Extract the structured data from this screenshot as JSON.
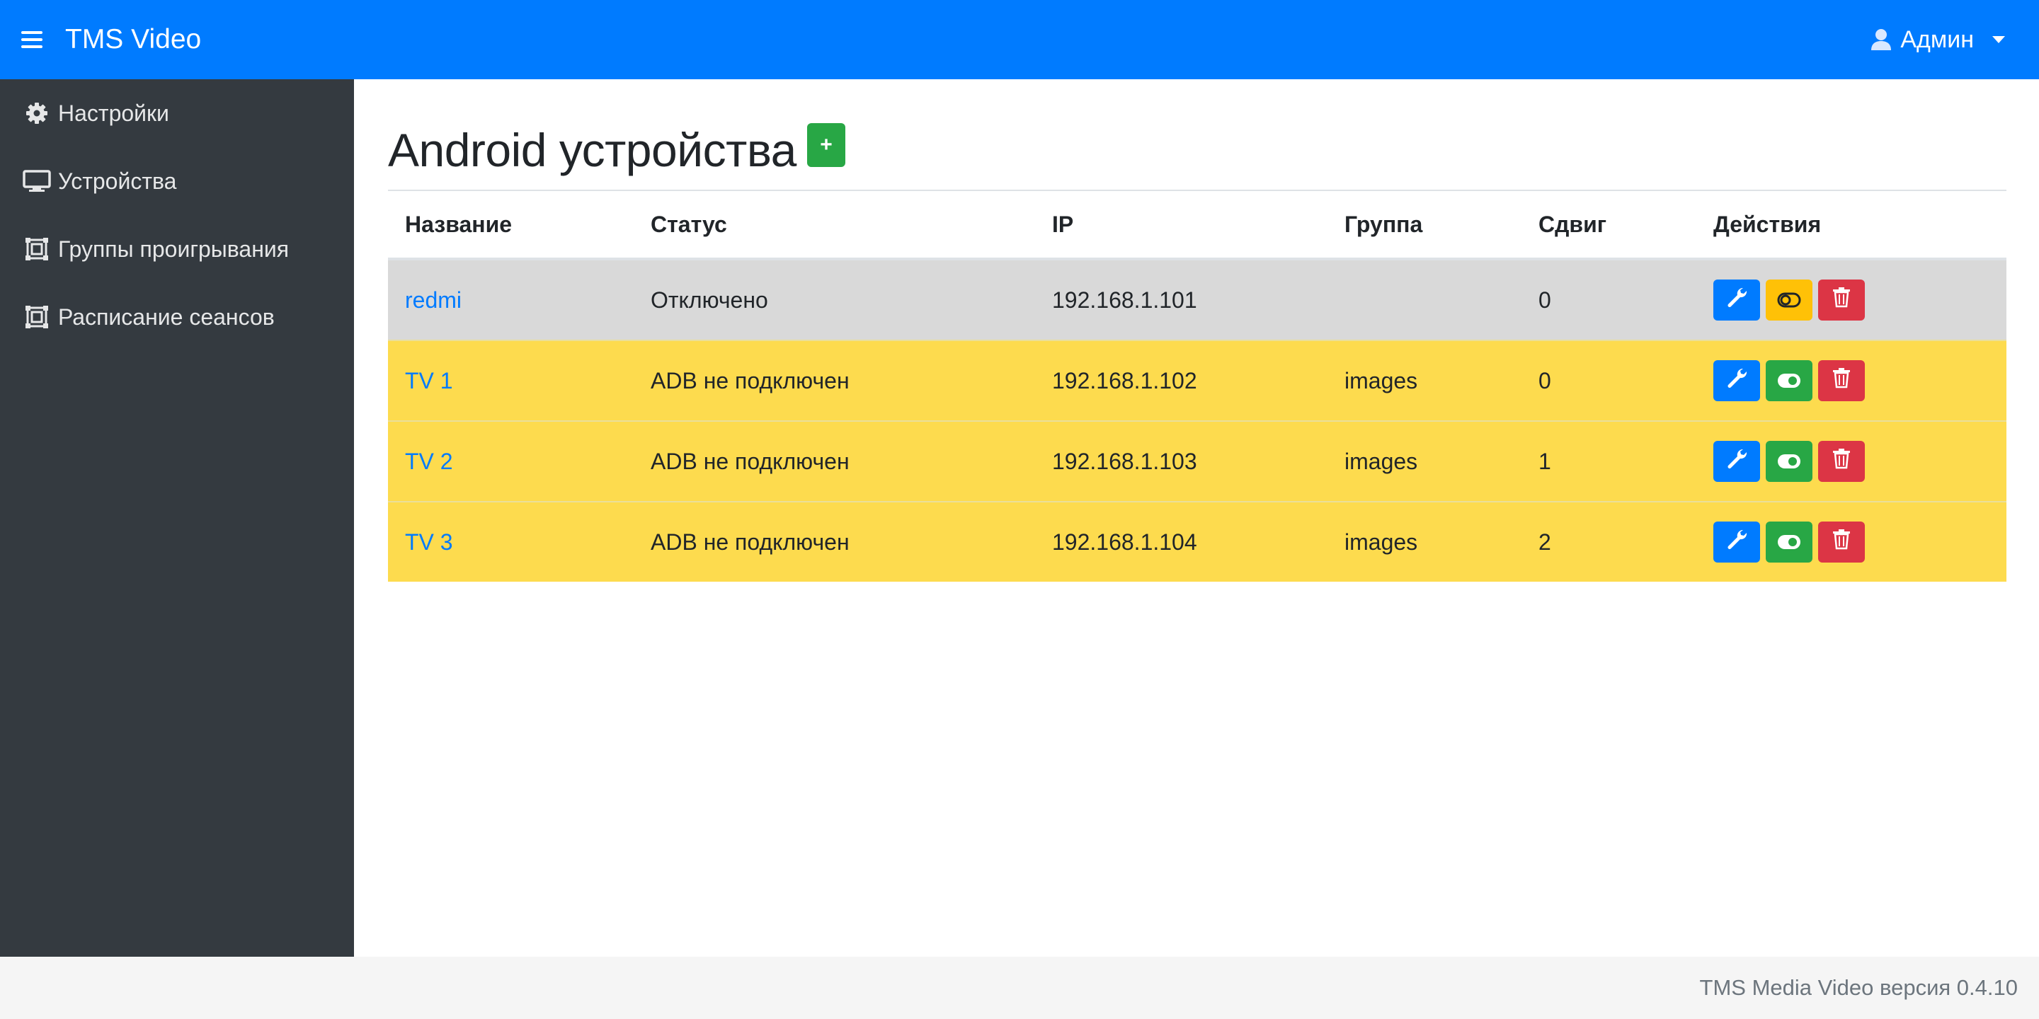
{
  "navbar": {
    "brand": "TMS Video",
    "user": "Админ",
    "menu_icon": "hamburger-icon",
    "user_icon": "user-icon"
  },
  "sidebar": {
    "items": [
      {
        "label": "Настройки",
        "icon": "gear-icon"
      },
      {
        "label": "Устройства",
        "icon": "monitor-icon"
      },
      {
        "label": "Группы проигрывания",
        "icon": "frame-icon"
      },
      {
        "label": "Расписание сеансов",
        "icon": "frame-icon"
      }
    ]
  },
  "main": {
    "title": "Android устройства",
    "add_label": "+",
    "table": {
      "headers": [
        "Название",
        "Статус",
        "IP",
        "Группа",
        "Сдвиг",
        "Действия"
      ],
      "rows": [
        {
          "name": "redmi",
          "status": "Отключено",
          "ip": "192.168.1.101",
          "group": "",
          "shift": "0",
          "toggle": "off"
        },
        {
          "name": "TV 1",
          "status": "ADB не подключен",
          "ip": "192.168.1.102",
          "group": "images",
          "shift": "0",
          "toggle": "on"
        },
        {
          "name": "TV 2",
          "status": "ADB не подключен",
          "ip": "192.168.1.103",
          "group": "images",
          "shift": "1",
          "toggle": "on"
        },
        {
          "name": "TV 3",
          "status": "ADB не подключен",
          "ip": "192.168.1.104",
          "group": "images",
          "shift": "2",
          "toggle": "on"
        }
      ]
    }
  },
  "footer": {
    "text": "TMS Media Video версия 0.4.10"
  },
  "colors": {
    "primary": "#007bff",
    "success": "#28a745",
    "warning": "#ffc107",
    "danger": "#dc3545",
    "sidebar": "#343a40",
    "row_warning": "#fddb4e",
    "row_disabled": "#d9d9d9"
  }
}
